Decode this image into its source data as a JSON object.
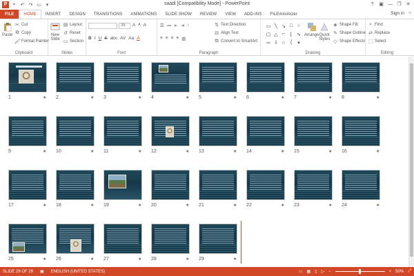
{
  "window": {
    "title": "saadi [Compatibility Mode] - PowerPoint",
    "app_logo": "P",
    "sign_in": "Sign in",
    "quick_access_icons": [
      "save-icon",
      "undo-icon",
      "redo-icon",
      "slideshow-start-icon"
    ],
    "controls": [
      "?",
      "—",
      "❐",
      "✕"
    ]
  },
  "tabs": [
    {
      "label": "FILE",
      "type": "file"
    },
    {
      "label": "HOME",
      "type": "active"
    },
    {
      "label": "INSERT",
      "type": "normal"
    },
    {
      "label": "DESIGN",
      "type": "normal"
    },
    {
      "label": "TRANSITIONS",
      "type": "normal"
    },
    {
      "label": "ANIMATIONS",
      "type": "normal"
    },
    {
      "label": "SLIDE SHOW",
      "type": "normal"
    },
    {
      "label": "REVIEW",
      "type": "normal"
    },
    {
      "label": "VIEW",
      "type": "normal"
    },
    {
      "label": "ADD-INS",
      "type": "normal"
    },
    {
      "label": "FILEminimizer",
      "type": "normal"
    }
  ],
  "ribbon": {
    "clipboard": {
      "label": "Clipboard",
      "paste": "Paste",
      "cut": "Cut",
      "copy": "Copy",
      "format_painter": "Format Painter"
    },
    "slides": {
      "label": "Slides",
      "new_slide": "New",
      "new_slide_2": "Slide",
      "layout": "Layout",
      "reset": "Reset",
      "section": "Section"
    },
    "font": {
      "label": "Font",
      "font_name": "",
      "font_size": "36",
      "grow": "A",
      "shrink": "A",
      "clear": "A",
      "bold": "B",
      "italic": "I",
      "underline": "U",
      "strike": "S",
      "shadow": "abc",
      "spacing": "AV",
      "case": "Aa",
      "color": "A"
    },
    "paragraph": {
      "label": "Paragraph",
      "text_direction": "Text Direction",
      "align_text": "Align Text",
      "convert_smartart": "Convert to SmartArt"
    },
    "drawing": {
      "label": "Drawing",
      "arrange": "Arrange",
      "quick_styles": "Quick",
      "quick_styles_2": "Styles",
      "shape_fill": "Shape Fill",
      "shape_outline": "Shape Outline",
      "shape_effects": "Shape Effects"
    },
    "editing": {
      "label": "Editing",
      "find": "Find",
      "replace": "Replace",
      "select": "Select"
    }
  },
  "slides": [
    {
      "num": "1",
      "kind": "title-person"
    },
    {
      "num": "2",
      "kind": "text"
    },
    {
      "num": "3",
      "kind": "text"
    },
    {
      "num": "4",
      "kind": "picture-top"
    },
    {
      "num": "5",
      "kind": "text"
    },
    {
      "num": "6",
      "kind": "text"
    },
    {
      "num": "7",
      "kind": "text"
    },
    {
      "num": "8",
      "kind": "text"
    },
    {
      "num": "9",
      "kind": "text"
    },
    {
      "num": "10",
      "kind": "text"
    },
    {
      "num": "11",
      "kind": "text"
    },
    {
      "num": "12",
      "kind": "picture-person"
    },
    {
      "num": "13",
      "kind": "text"
    },
    {
      "num": "14",
      "kind": "text"
    },
    {
      "num": "15",
      "kind": "text"
    },
    {
      "num": "16",
      "kind": "text"
    },
    {
      "num": "17",
      "kind": "text"
    },
    {
      "num": "18",
      "kind": "text"
    },
    {
      "num": "19",
      "kind": "picture-landscape"
    },
    {
      "num": "20",
      "kind": "text"
    },
    {
      "num": "21",
      "kind": "text"
    },
    {
      "num": "22",
      "kind": "text"
    },
    {
      "num": "23",
      "kind": "text"
    },
    {
      "num": "24",
      "kind": "text"
    },
    {
      "num": "25",
      "kind": "picture-landscape-small"
    },
    {
      "num": "26",
      "kind": "picture-person-small"
    },
    {
      "num": "27",
      "kind": "text"
    },
    {
      "num": "28",
      "kind": "text"
    },
    {
      "num": "29",
      "kind": "text"
    }
  ],
  "slide_star": "★",
  "status": {
    "slide_count": "SLIDE 29 OF 29",
    "language": "ENGLISH (UNITED STATES)",
    "zoom": "50%",
    "zoom_fraction": 0.5,
    "accent": "#d24726"
  },
  "colors": {
    "accent": "#d24726",
    "slide_bg": "#1f4859"
  }
}
